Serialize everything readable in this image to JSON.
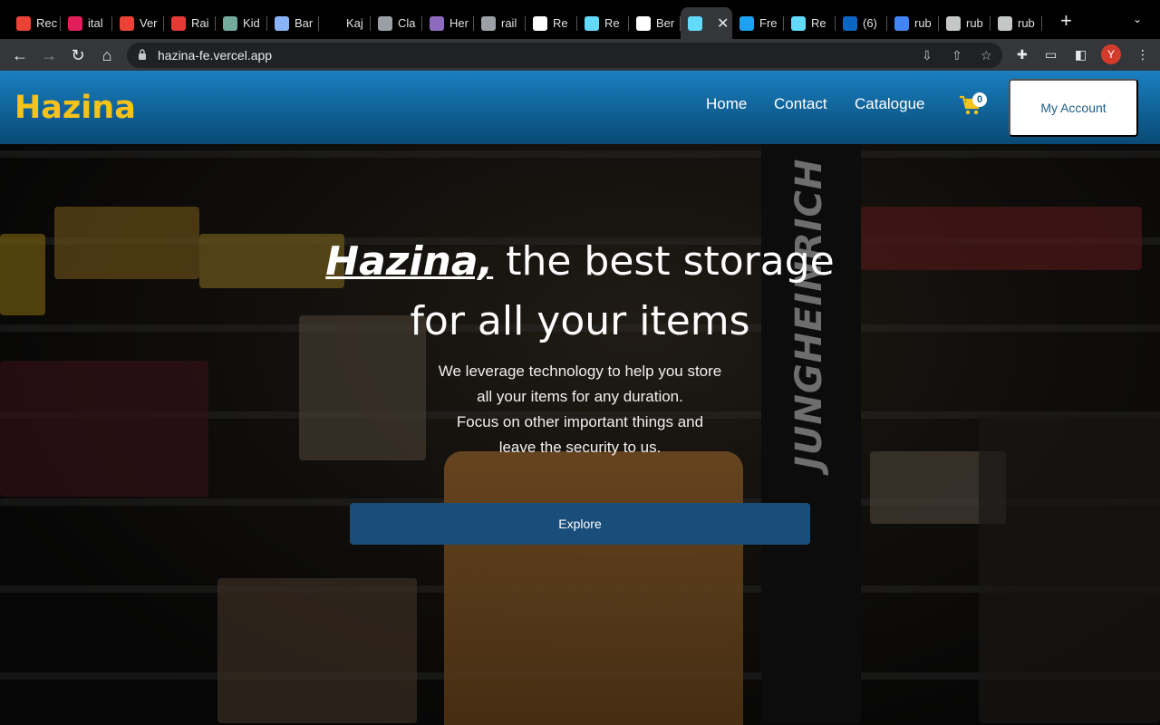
{
  "browser": {
    "tabs": [
      {
        "label": "Rec",
        "icon": "gmail-icon",
        "color": "#ea4335"
      },
      {
        "label": "ital",
        "icon": "slack-icon",
        "color": "#e01e5a"
      },
      {
        "label": "Ver",
        "icon": "gmail-icon",
        "color": "#ea4335"
      },
      {
        "label": "Rai",
        "icon": "loader-icon",
        "color": "#e53935"
      },
      {
        "label": "Kid",
        "icon": "chatgpt-icon",
        "color": "#74aa9c"
      },
      {
        "label": "Bar",
        "icon": "sparkle-icon",
        "color": "#8ab4f8"
      },
      {
        "label": "Kaj",
        "icon": "blank-icon",
        "color": "#000000"
      },
      {
        "label": "Cla",
        "icon": "cloud-icon",
        "color": "#9aa0a6"
      },
      {
        "label": "Her",
        "icon": "heroku-icon",
        "color": "#8e6bbf"
      },
      {
        "label": "rail",
        "icon": "globe-icon",
        "color": "#9aa0a6"
      },
      {
        "label": "Re",
        "icon": "mark-icon",
        "color": "#ffffff"
      },
      {
        "label": "Re",
        "icon": "react-icon",
        "color": "#61dafb"
      },
      {
        "label": "Ber",
        "icon": "github-icon",
        "color": "#ffffff"
      },
      {
        "label": "",
        "icon": "react-icon",
        "color": "#61dafb",
        "active": true
      },
      {
        "label": "Fre",
        "icon": "c-icon",
        "color": "#1da1f2"
      },
      {
        "label": "Re",
        "icon": "react-icon",
        "color": "#61dafb"
      },
      {
        "label": "(6)",
        "icon": "linkedin-icon",
        "color": "#0a66c2"
      },
      {
        "label": "rub",
        "icon": "google-icon",
        "color": "#4285f4"
      },
      {
        "label": "rub",
        "icon": "rubygems-icon",
        "color": "#c4c7c5"
      },
      {
        "label": "rub",
        "icon": "rubygems-icon",
        "color": "#c4c7c5"
      }
    ],
    "new_tab": "+",
    "url": "hazina-fe.vercel.app",
    "profile_initial": "Y"
  },
  "navbar": {
    "logo": "Hazina",
    "links": [
      "Home",
      "Contact",
      "Catalogue"
    ],
    "cart_count": "0",
    "account": "My Account",
    "accent": "#f7c21a"
  },
  "hero": {
    "headline_brand": "Hazina,",
    "headline_rest": " the best storage",
    "headline_line2": "for all your items",
    "sub": [
      "We leverage technology to help you store",
      "all your items for any duration.",
      "Focus on other important things and",
      "leave the security to us."
    ],
    "cta": "Explore"
  }
}
